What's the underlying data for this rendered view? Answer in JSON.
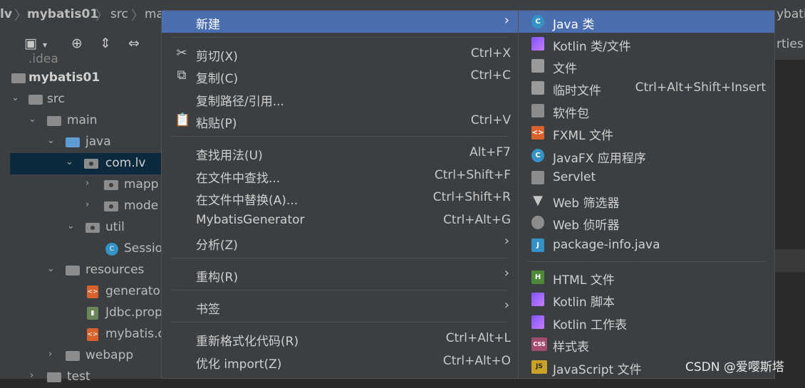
{
  "breadcrumb": [
    "lv",
    "mybatis01",
    "src",
    "ma"
  ],
  "right_tabs": [
    "ybatis",
    "rties"
  ],
  "tree": [
    {
      "label": ".idea",
      "bold": false
    },
    {
      "label": "mybatis01",
      "bold": true
    },
    {
      "label": "src"
    },
    {
      "label": "main"
    },
    {
      "label": "java"
    },
    {
      "label": "com.lv"
    },
    {
      "label": "mapp"
    },
    {
      "label": "mode"
    },
    {
      "label": "util"
    },
    {
      "label": "Sessio"
    },
    {
      "label": "resources"
    },
    {
      "label": "generato"
    },
    {
      "label": "Jdbc.prop"
    },
    {
      "label": "mybatis.c"
    },
    {
      "label": "webapp"
    },
    {
      "label": "test"
    }
  ],
  "menu": [
    {
      "label": "新建",
      "shortcut": "",
      "submenu": "›",
      "icon": ""
    },
    {
      "label": "剪切(X)",
      "shortcut": "Ctrl+X",
      "icon": "scissors-icon"
    },
    {
      "label": "复制(C)",
      "shortcut": "Ctrl+C",
      "icon": "copy-icon"
    },
    {
      "label": "复制路径/引用...",
      "shortcut": ""
    },
    {
      "label": "粘贴(P)",
      "shortcut": "Ctrl+V",
      "icon": "paste-icon"
    },
    {
      "label": "查找用法(U)",
      "shortcut": "Alt+F7"
    },
    {
      "label": "在文件中查找...",
      "shortcut": "Ctrl+Shift+F"
    },
    {
      "label": "在文件中替换(A)...",
      "shortcut": "Ctrl+Shift+R"
    },
    {
      "label": "MybatisGenerator",
      "shortcut": "Ctrl+Alt+G"
    },
    {
      "label": "分析(Z)",
      "submenu": "›"
    },
    {
      "label": "重构(R)",
      "submenu": "›"
    },
    {
      "label": "书签",
      "submenu": "›"
    },
    {
      "label": "重新格式化代码(R)",
      "shortcut": "Ctrl+Alt+L"
    },
    {
      "label": "优化 import(Z)",
      "shortcut": "Ctrl+Alt+O"
    }
  ],
  "submenu": [
    {
      "label": "Java 类",
      "icon_text": "C"
    },
    {
      "label": "Kotlin 类/文件",
      "icon_text": ""
    },
    {
      "label": "文件",
      "icon_text": ""
    },
    {
      "label": "临时文件",
      "shortcut": "Ctrl+Alt+Shift+Insert",
      "icon_text": ""
    },
    {
      "label": "软件包",
      "icon_text": ""
    },
    {
      "label": "FXML 文件",
      "icon_text": "<>"
    },
    {
      "label": "JavaFX 应用程序",
      "icon_text": "C"
    },
    {
      "label": "Servlet",
      "icon_text": ""
    },
    {
      "label": "Web 筛选器",
      "icon_text": ""
    },
    {
      "label": "Web 侦听器",
      "icon_text": ""
    },
    {
      "label": "package-info.java",
      "icon_text": "J"
    },
    {
      "label": "HTML 文件",
      "icon_text": "H"
    },
    {
      "label": "Kotlin 脚本",
      "icon_text": ""
    },
    {
      "label": "Kotlin 工作表",
      "icon_text": ""
    },
    {
      "label": "样式表",
      "icon_text": "CSS"
    },
    {
      "label": "JavaScript 文件",
      "icon_text": "JS"
    }
  ],
  "watermark": "CSDN @爱嘤斯塔",
  "colors": {
    "highlight": "#4b6eaf",
    "menu_bg": "#3c3f41",
    "selection": "#0d293e"
  }
}
